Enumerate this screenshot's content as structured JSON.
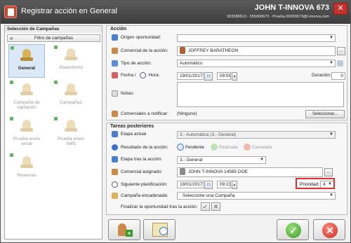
{
  "window": {
    "title": "Registrar acción en General",
    "close_glyph": "✕"
  },
  "user": {
    "name": "JOHN T-INNOVA 673",
    "info": "933388613 - 555000673 - Prueba.00000673@t-innova.com"
  },
  "sidebar": {
    "title": "Selección de Campañas",
    "filter_label": "Filtro de campañas",
    "chevron": "«",
    "campaigns": [
      {
        "label": "General",
        "selected": true
      },
      {
        "label": "Absentismo",
        "selected": false
      },
      {
        "label": "Campaña de captación",
        "selected": false
      },
      {
        "label": "Campaña1",
        "selected": false
      },
      {
        "label": "Prueba envio email",
        "selected": false
      },
      {
        "label": "Prueba envio SMS",
        "selected": false
      },
      {
        "label": "Reservas",
        "selected": false
      }
    ]
  },
  "accion": {
    "section_title": "Acción",
    "origen_label": "Origen oportunidad:",
    "origen_value": "",
    "comercial_label": "Comercial de la acción:",
    "comercial_value": "JOFFREY BARATHEON",
    "tipo_label": "Tipo de acción:",
    "tipo_value": "Automático",
    "fecha_label": "Fecha /",
    "hora_label": "Hora:",
    "fecha_value": "19/01/2017",
    "cal_label": "15",
    "hora_value": "09:59",
    "duracion_label": "Duración:",
    "duracion_value": "0",
    "notas_label": "Notas:",
    "notas_value": "",
    "comerciales_notificar_label": "Comerciales a notificar:",
    "comerciales_notificar_value": "(Ninguno)",
    "seleccionar_label": "Seleccionar...",
    "more_label": "..."
  },
  "tareas": {
    "section_title": "Tareas posteriores",
    "etapa_actual_label": "Etapa actual",
    "etapa_actual_value": "3.- Automática (3.- General)",
    "resultado_label": "Resultado de la acción:",
    "pendiente_label": "Pendiente",
    "realizada_label": "Realizada",
    "cancelada_label": "Cancelada",
    "etapa_tras_label": "Etapa tras la acción:",
    "etapa_tras_value": "3.- General",
    "comercial_asignado_label": "Comercial asignado:",
    "comercial_asignado_value": "JOHN T-INNOVA 14585 DOE",
    "siguiente_label": "Siguiente planificación:",
    "siguiente_fecha": "19/01/2017",
    "cal_label": "15",
    "siguiente_hora": "09:23",
    "prioridad_label": "Prioridad:",
    "prioridad_value": "4",
    "campana_label": "Campaña encadenada:",
    "campana_value": "Seleccione una Campaña",
    "finalizar_label": "Finalizar la oportunidad tras la acción:",
    "more_label": "..."
  },
  "colors": {
    "accent": "#3d3d3d",
    "highlight": "#e03030",
    "ok": "#3a9a2a",
    "cancel": "#c8281c"
  }
}
